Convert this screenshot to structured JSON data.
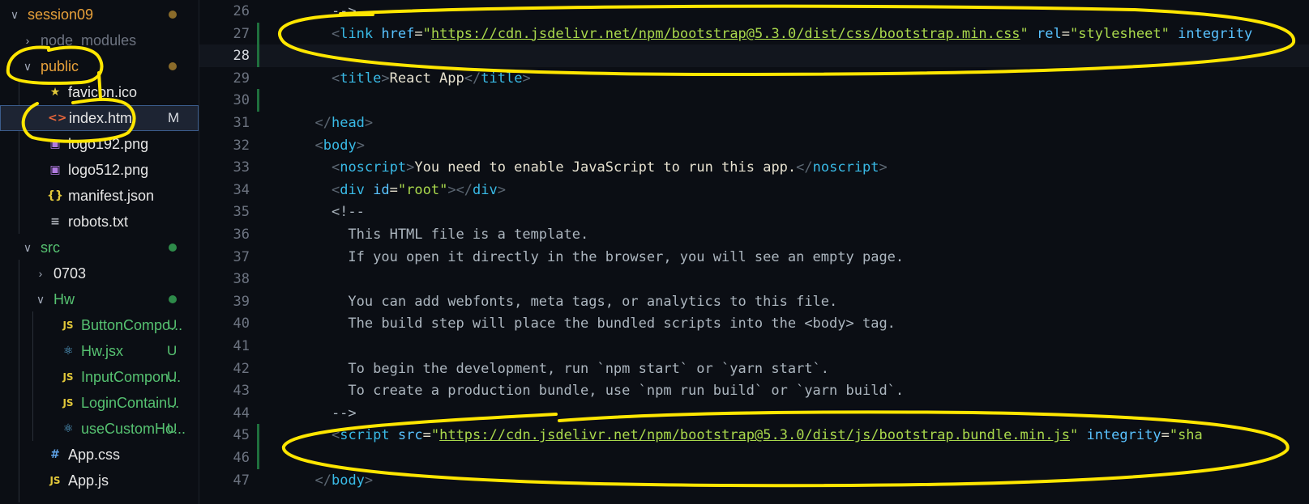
{
  "explorer": {
    "items": [
      {
        "name": "session09",
        "chevron": "∨",
        "color": "#e8a13a",
        "dot": "#8a6b2a"
      },
      {
        "name": "node_modules",
        "chevron": "›",
        "color": "#6d7380"
      },
      {
        "name": "public",
        "chevron": "∨",
        "color": "#e8a13a",
        "dot": "#8a6b2a"
      },
      {
        "name": "favicon.ico",
        "icon": "★",
        "color": "#e6e6e6"
      },
      {
        "name": "index.html",
        "icon": "<>",
        "color": "#e6e6e6",
        "badge": "M"
      },
      {
        "name": "logo192.png",
        "icon": "▣",
        "color": "#e6e6e6"
      },
      {
        "name": "logo512.png",
        "icon": "▣",
        "color": "#e6e6e6"
      },
      {
        "name": "manifest.json",
        "icon": "{}",
        "color": "#e6e6e6"
      },
      {
        "name": "robots.txt",
        "icon": "≡",
        "color": "#e6e6e6"
      },
      {
        "name": "src",
        "chevron": "∨",
        "color": "#56c271",
        "dot": "#2e8b4a"
      },
      {
        "name": "0703",
        "chevron": "›",
        "color": "#e6e6e6"
      },
      {
        "name": "Hw",
        "chevron": "∨",
        "color": "#56c271",
        "dot": "#2e8b4a"
      },
      {
        "name": "ButtonCompo...",
        "icon": "JS",
        "color": "#56c271",
        "badge": "U"
      },
      {
        "name": "Hw.jsx",
        "icon": "⚛",
        "color": "#56c271",
        "badge": "U"
      },
      {
        "name": "InputCompon...",
        "icon": "JS",
        "color": "#56c271",
        "badge": "U"
      },
      {
        "name": "LoginContain...",
        "icon": "JS",
        "color": "#56c271",
        "badge": "U"
      },
      {
        "name": "useCustomHo...",
        "icon": "⚛",
        "color": "#56c271",
        "badge": "U"
      },
      {
        "name": "App.css",
        "icon": "#",
        "color": "#e6e6e6"
      },
      {
        "name": "App.js",
        "icon": "JS",
        "color": "#e6e6e6"
      }
    ]
  },
  "editor": {
    "lines": [
      {
        "n": "26",
        "code": [
          [
            "cmt",
            "    -->"
          ]
        ]
      },
      {
        "n": "27",
        "code": [
          [
            "txt",
            "    "
          ],
          [
            "pun",
            "<"
          ],
          [
            "tag",
            "link"
          ],
          [
            "txt",
            " "
          ],
          [
            "attr",
            "href"
          ],
          [
            "txt",
            "="
          ],
          [
            "str",
            "\""
          ],
          [
            "url",
            "https://cdn.jsdelivr.net/npm/bootstrap@5.3.0/dist/css/bootstrap.min.css"
          ],
          [
            "str",
            "\""
          ],
          [
            "txt",
            " "
          ],
          [
            "attr",
            "rel"
          ],
          [
            "txt",
            "="
          ],
          [
            "str",
            "\"stylesheet\""
          ],
          [
            "txt",
            " "
          ],
          [
            "attr",
            "integrity"
          ]
        ]
      },
      {
        "n": "28",
        "code": [],
        "current": true
      },
      {
        "n": "29",
        "code": [
          [
            "txt",
            "    "
          ],
          [
            "pun",
            "<"
          ],
          [
            "tag",
            "title"
          ],
          [
            "pun",
            ">"
          ],
          [
            "txt",
            "React App"
          ],
          [
            "pun",
            "</"
          ],
          [
            "tag",
            "title"
          ],
          [
            "pun",
            ">"
          ]
        ]
      },
      {
        "n": "30",
        "code": []
      },
      {
        "n": "31",
        "code": [
          [
            "txt",
            "  "
          ],
          [
            "pun",
            "</"
          ],
          [
            "tag",
            "head"
          ],
          [
            "pun",
            ">"
          ]
        ]
      },
      {
        "n": "32",
        "code": [
          [
            "txt",
            "  "
          ],
          [
            "pun",
            "<"
          ],
          [
            "tag",
            "body"
          ],
          [
            "pun",
            ">"
          ]
        ]
      },
      {
        "n": "33",
        "code": [
          [
            "txt",
            "    "
          ],
          [
            "pun",
            "<"
          ],
          [
            "tag",
            "noscript"
          ],
          [
            "pun",
            ">"
          ],
          [
            "txt",
            "You need to enable JavaScript to run this app."
          ],
          [
            "pun",
            "</"
          ],
          [
            "tag",
            "noscript"
          ],
          [
            "pun",
            ">"
          ]
        ]
      },
      {
        "n": "34",
        "code": [
          [
            "txt",
            "    "
          ],
          [
            "pun",
            "<"
          ],
          [
            "tag",
            "div"
          ],
          [
            "txt",
            " "
          ],
          [
            "attr",
            "id"
          ],
          [
            "txt",
            "="
          ],
          [
            "str",
            "\"root\""
          ],
          [
            "pun",
            "></"
          ],
          [
            "tag",
            "div"
          ],
          [
            "pun",
            ">"
          ]
        ]
      },
      {
        "n": "35",
        "code": [
          [
            "cmt",
            "    <!--"
          ]
        ]
      },
      {
        "n": "36",
        "code": [
          [
            "cmt",
            "      This HTML file is a template."
          ]
        ]
      },
      {
        "n": "37",
        "code": [
          [
            "cmt",
            "      If you open it directly in the browser, you will see an empty page."
          ]
        ]
      },
      {
        "n": "38",
        "code": []
      },
      {
        "n": "39",
        "code": [
          [
            "cmt",
            "      You can add webfonts, meta tags, or analytics to this file."
          ]
        ]
      },
      {
        "n": "40",
        "code": [
          [
            "cmt",
            "      The build step will place the bundled scripts into the <body> tag."
          ]
        ]
      },
      {
        "n": "41",
        "code": []
      },
      {
        "n": "42",
        "code": [
          [
            "cmt",
            "      To begin the development, run `npm start` or `yarn start`."
          ]
        ]
      },
      {
        "n": "43",
        "code": [
          [
            "cmt",
            "      To create a production bundle, use `npm run build` or `yarn build`."
          ]
        ]
      },
      {
        "n": "44",
        "code": [
          [
            "cmt",
            "    -->"
          ]
        ]
      },
      {
        "n": "45",
        "code": [
          [
            "txt",
            "    "
          ],
          [
            "pun",
            "<"
          ],
          [
            "tag",
            "script"
          ],
          [
            "txt",
            " "
          ],
          [
            "attr",
            "src"
          ],
          [
            "txt",
            "="
          ],
          [
            "str",
            "\""
          ],
          [
            "url",
            "https://cdn.jsdelivr.net/npm/bootstrap@5.3.0/dist/js/bootstrap.bundle.min.js"
          ],
          [
            "str",
            "\""
          ],
          [
            "txt",
            " "
          ],
          [
            "attr",
            "integrity"
          ],
          [
            "txt",
            "="
          ],
          [
            "str",
            "\"sha"
          ]
        ]
      },
      {
        "n": "46",
        "code": []
      },
      {
        "n": "47",
        "code": [
          [
            "txt",
            "  "
          ],
          [
            "pun",
            "</"
          ],
          [
            "tag",
            "body"
          ],
          [
            "pun",
            ">"
          ]
        ]
      }
    ]
  },
  "annotation_color": "#ffe600"
}
